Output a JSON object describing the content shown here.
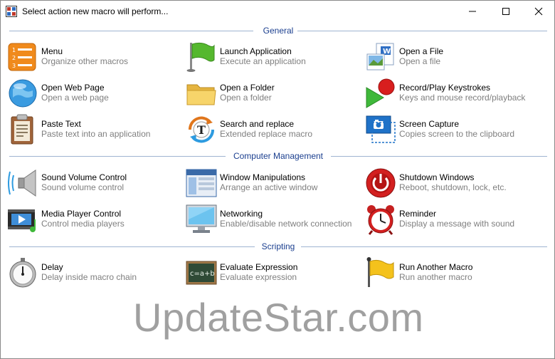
{
  "window": {
    "title": "Select action new macro will perform...",
    "buttons": {
      "minimize": "minimize-icon",
      "maximize": "maximize-icon",
      "close": "close-icon"
    }
  },
  "sections": {
    "general": "General",
    "computer_management": "Computer Management",
    "scripting": "Scripting"
  },
  "items": {
    "menu": {
      "name": "Menu",
      "desc": "Organize other macros",
      "icon": "numbered-list-icon"
    },
    "launch_app": {
      "name": "Launch Application",
      "desc": "Execute an application",
      "icon": "green-flag-icon"
    },
    "open_file": {
      "name": "Open a File",
      "desc": "Open a file",
      "icon": "documents-icon"
    },
    "open_web": {
      "name": "Open Web Page",
      "desc": "Open a web page",
      "icon": "globe-icon"
    },
    "open_folder": {
      "name": "Open a Folder",
      "desc": "Open a folder",
      "icon": "folder-icon"
    },
    "record_play": {
      "name": "Record/Play Keystrokes",
      "desc": "Keys and mouse record/playback",
      "icon": "record-play-icon"
    },
    "paste_text": {
      "name": "Paste Text",
      "desc": "Paste text into an application",
      "icon": "clipboard-icon"
    },
    "search_replace": {
      "name": "Search and replace",
      "desc": "Extended replace macro",
      "icon": "search-replace-icon"
    },
    "screen_capture": {
      "name": "Screen Capture",
      "desc": "Copies screen to the clipboard",
      "icon": "screen-capture-icon"
    },
    "sound_volume": {
      "name": "Sound Volume Control",
      "desc": "Sound volume control",
      "icon": "speaker-icon"
    },
    "window_manip": {
      "name": "Window Manipulations",
      "desc": "Arrange an active window",
      "icon": "window-icon"
    },
    "shutdown": {
      "name": "Shutdown Windows",
      "desc": "Reboot, shutdown, lock, etc.",
      "icon": "power-icon"
    },
    "media_player": {
      "name": "Media Player Control",
      "desc": "Control media players",
      "icon": "media-player-icon"
    },
    "networking": {
      "name": "Networking",
      "desc": "Enable/disable network connection",
      "icon": "monitor-icon"
    },
    "reminder": {
      "name": "Reminder",
      "desc": "Display a message with sound",
      "icon": "alarm-clock-icon"
    },
    "delay": {
      "name": "Delay",
      "desc": "Delay inside macro chain",
      "icon": "stopwatch-icon"
    },
    "evaluate": {
      "name": "Evaluate Expression",
      "desc": "Evaluate expression",
      "icon": "chalkboard-icon"
    },
    "run_macro": {
      "name": "Run Another Macro",
      "desc": "Run another macro",
      "icon": "yellow-flag-icon"
    }
  },
  "watermark": "UpdateStar.com"
}
